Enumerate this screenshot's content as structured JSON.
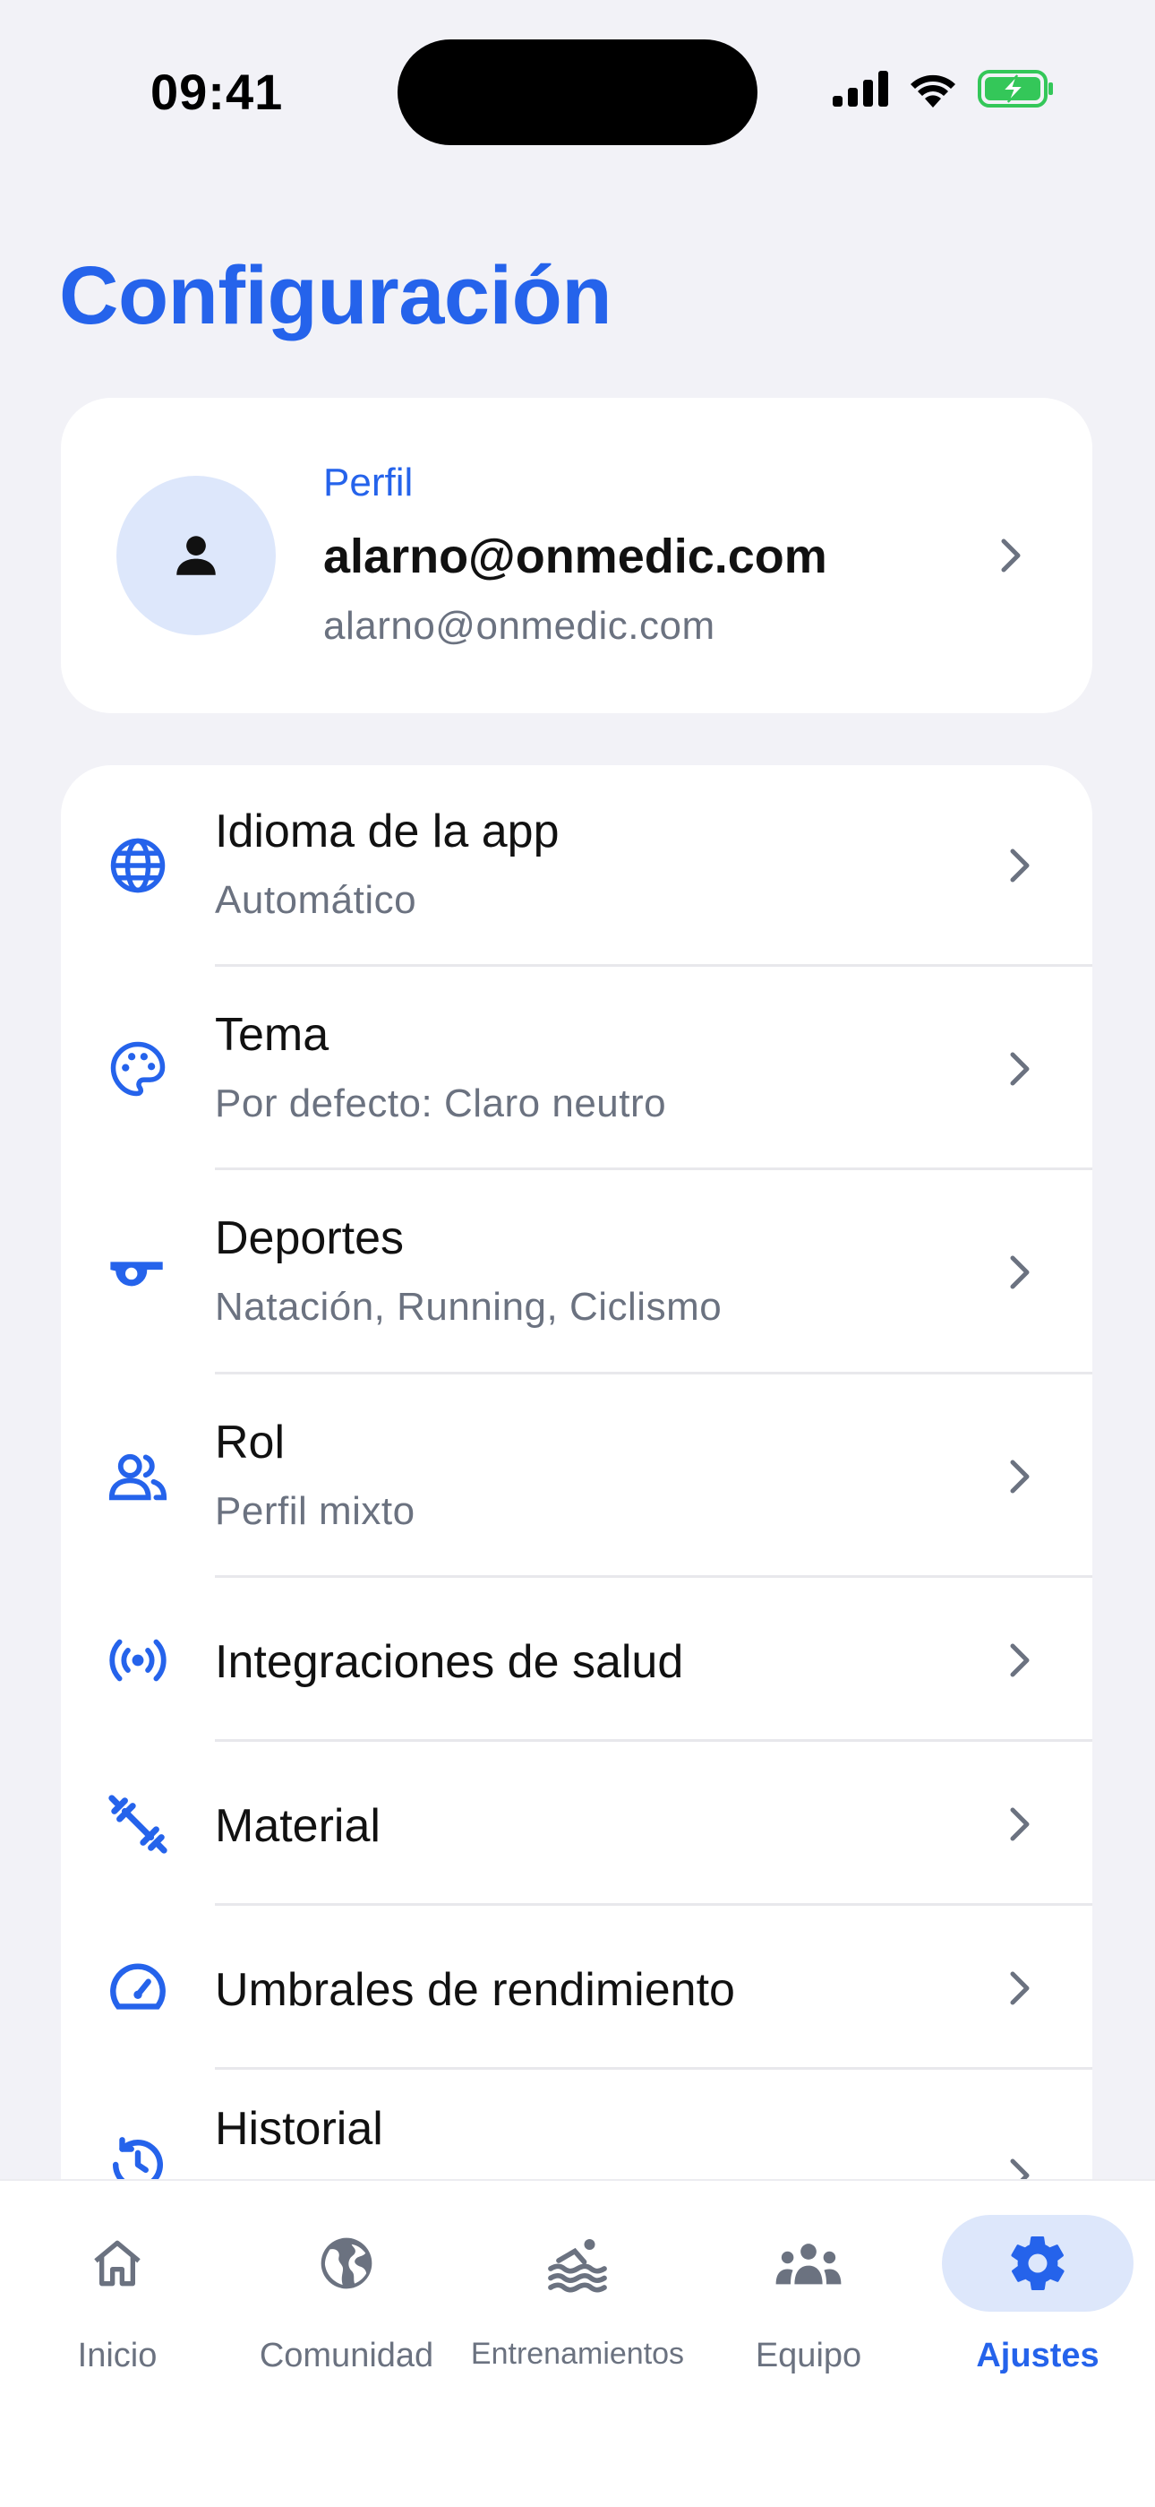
{
  "status_bar": {
    "time": "09:41"
  },
  "page_title": "Configuración",
  "profile": {
    "label": "Perfil",
    "name": "alarno@onmedic.com",
    "email": "alarno@onmedic.com"
  },
  "settings": [
    {
      "icon": "globe-icon",
      "title": "Idioma de la app",
      "subtitle": "Automático"
    },
    {
      "icon": "palette-icon",
      "title": "Tema",
      "subtitle": "Por defecto: Claro neutro"
    },
    {
      "icon": "whistle-icon",
      "title": "Deportes",
      "subtitle": "Natación, Running, Ciclismo"
    },
    {
      "icon": "people-icon",
      "title": "Rol",
      "subtitle": "Perfil mixto"
    },
    {
      "icon": "sensors-icon",
      "title": "Integraciones de salud"
    },
    {
      "icon": "dumbbell-icon",
      "title": "Material"
    },
    {
      "icon": "speedometer-icon",
      "title": "Umbrales de rendimiento"
    },
    {
      "icon": "history-icon",
      "title": "Historial"
    }
  ],
  "tabs": [
    {
      "icon": "home-icon",
      "label": "Inicio"
    },
    {
      "icon": "globe-icon",
      "label": "Comunidad"
    },
    {
      "icon": "swim-icon",
      "label": "Entrenamientos"
    },
    {
      "icon": "group-icon",
      "label": "Equipo"
    },
    {
      "icon": "gear-icon",
      "label": "Ajustes",
      "active": true
    }
  ],
  "colors": {
    "accent": "#2563eb",
    "accent_soft": "#dde7fb",
    "background": "#f2f2f7",
    "muted_text": "#6b7280",
    "battery": "#34c759"
  }
}
